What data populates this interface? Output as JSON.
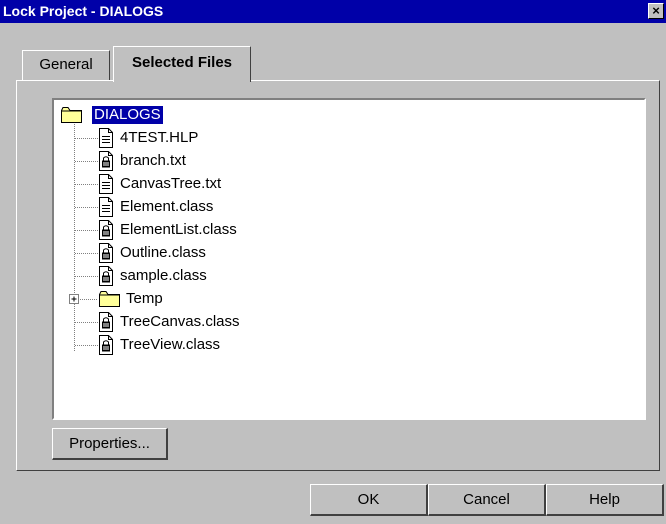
{
  "window": {
    "title": "Lock Project - DIALOGS",
    "close_glyph": "×"
  },
  "tabs": [
    {
      "label": "General",
      "selected": false
    },
    {
      "label": "Selected Files",
      "selected": true
    }
  ],
  "tree": {
    "root": {
      "label": "DIALOGS",
      "icon": "folder-icon",
      "selected": true
    },
    "items": [
      {
        "label": "4TEST.HLP",
        "icon": "document-icon"
      },
      {
        "label": "branch.txt",
        "icon": "locked-document-icon"
      },
      {
        "label": "CanvasTree.txt",
        "icon": "document-icon"
      },
      {
        "label": "Element.class",
        "icon": "document-icon"
      },
      {
        "label": "ElementList.class",
        "icon": "locked-document-icon"
      },
      {
        "label": "Outline.class",
        "icon": "locked-document-icon"
      },
      {
        "label": "sample.class",
        "icon": "locked-document-icon"
      },
      {
        "label": "Temp",
        "icon": "folder-icon",
        "expandable": true
      },
      {
        "label": "TreeCanvas.class",
        "icon": "locked-document-icon"
      },
      {
        "label": "TreeView.class",
        "icon": "locked-document-icon"
      }
    ]
  },
  "buttons": {
    "properties": "Properties...",
    "ok": "OK",
    "cancel": "Cancel",
    "help": "Help"
  }
}
